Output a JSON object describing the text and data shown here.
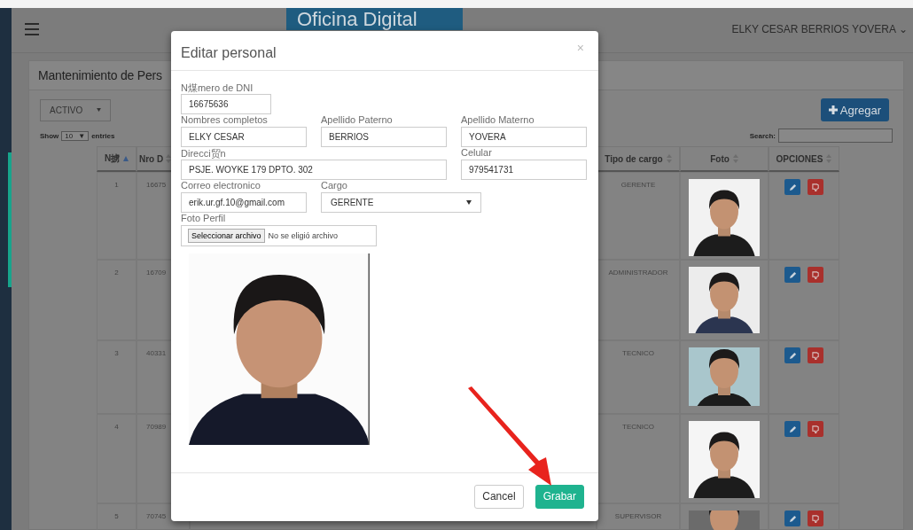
{
  "header": {
    "logo_text": "Oficina Digital",
    "user_name": "ELKY CESAR BERRIOS YOVERA",
    "user_caret": "⌄"
  },
  "panel": {
    "title": "Mantenimiento de Pers",
    "status_filter": "ACTIVO",
    "show_label": "Show",
    "page_size": "10",
    "page_size_caret": "▼",
    "entries_label": "entries",
    "search_label": "Search:",
    "add_button": "Agregar"
  },
  "table": {
    "columns": [
      {
        "label": "N掳",
        "sorted": true
      },
      {
        "label": "Nro D",
        "sorted": false
      },
      {
        "label": "Tipo de cargo",
        "sorted": false
      },
      {
        "label": "Foto",
        "sorted": false
      },
      {
        "label": "OPCIONES",
        "sorted": false
      }
    ],
    "rows": [
      {
        "number": "1",
        "dni": "16675",
        "cargo": "GERENTE"
      },
      {
        "number": "2",
        "dni": "16709",
        "cargo": "ADMINISTRADOR"
      },
      {
        "number": "3",
        "dni": "40331",
        "cargo": "TECNICO"
      },
      {
        "number": "4",
        "dni": "70989",
        "cargo": "TECNICO"
      },
      {
        "number": "5",
        "dni": "70745",
        "cargo": "SUPERVISOR"
      }
    ]
  },
  "modal": {
    "title": "Editar personal",
    "close": "×",
    "fields": [
      {
        "kind": "line",
        "label": "N煤mero de DNI",
        "value": "16675636"
      },
      {
        "kind": "text",
        "label": "Nombres completos",
        "value": "ELKY CESAR"
      },
      {
        "kind": "text",
        "label": "Apellido Paterno",
        "value": "BERRIOS"
      },
      {
        "kind": "text",
        "label": "Apellido Materno",
        "value": "YOVERA"
      },
      {
        "kind": "wide",
        "label": "Direcci贸n",
        "value": "PSJE. WOYKE 179 DPTO. 302"
      },
      {
        "kind": "text",
        "label": "Celular",
        "value": "979541731"
      },
      {
        "kind": "text",
        "label": "Correo electronico",
        "value": "erik.ur.gf.10@gmail.com"
      },
      {
        "kind": "select",
        "label": "Cargo",
        "value": "GERENTE"
      },
      {
        "kind": "file",
        "label": "Foto Perfil",
        "button": "Seleccionar archivo",
        "value": "No se eligió archivo"
      }
    ],
    "cancel_button": "Cancel",
    "save_button": "Grabar"
  }
}
